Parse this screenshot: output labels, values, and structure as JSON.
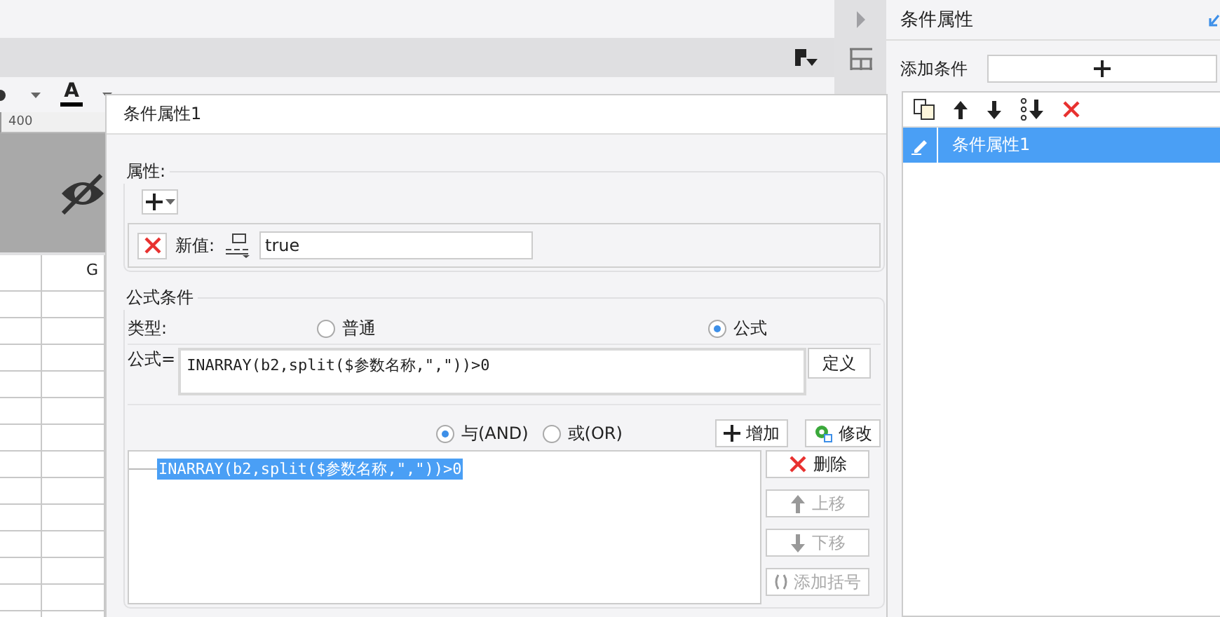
{
  "editor": {
    "font_color_glyph": "A",
    "ruler_label": "400",
    "column_header": "G"
  },
  "panel": {
    "title": "条件属性",
    "add_label": "添加条件",
    "conditions": [
      {
        "label": "条件属性1",
        "selected": true
      }
    ]
  },
  "dialog": {
    "title": "条件属性1",
    "properties": {
      "legend": "属性:",
      "rows": [
        {
          "label": "新值:",
          "value": "true"
        }
      ]
    },
    "formula": {
      "legend": "公式条件",
      "type_label": "类型:",
      "types": [
        {
          "label": "普通",
          "selected": false
        },
        {
          "label": "公式",
          "selected": true
        }
      ],
      "formula_label": "公式=",
      "formula_value": "INARRAY(b2,split($参数名称,\",\"))>0",
      "define_button": "定义",
      "joins": [
        {
          "label": "与(AND)",
          "selected": true
        },
        {
          "label": "或(OR)",
          "selected": false
        }
      ],
      "add_button": "增加",
      "modify_button": "修改",
      "conditions": [
        {
          "text": "INARRAY(b2,split($参数名称,\",\"))>0",
          "selected": true
        }
      ],
      "actions": [
        {
          "kind": "delete",
          "label": "删除",
          "disabled": false
        },
        {
          "kind": "up",
          "label": "上移",
          "disabled": true
        },
        {
          "kind": "down",
          "label": "下移",
          "disabled": true
        },
        {
          "kind": "bracket",
          "label": "添加括号",
          "disabled": true
        }
      ]
    }
  }
}
